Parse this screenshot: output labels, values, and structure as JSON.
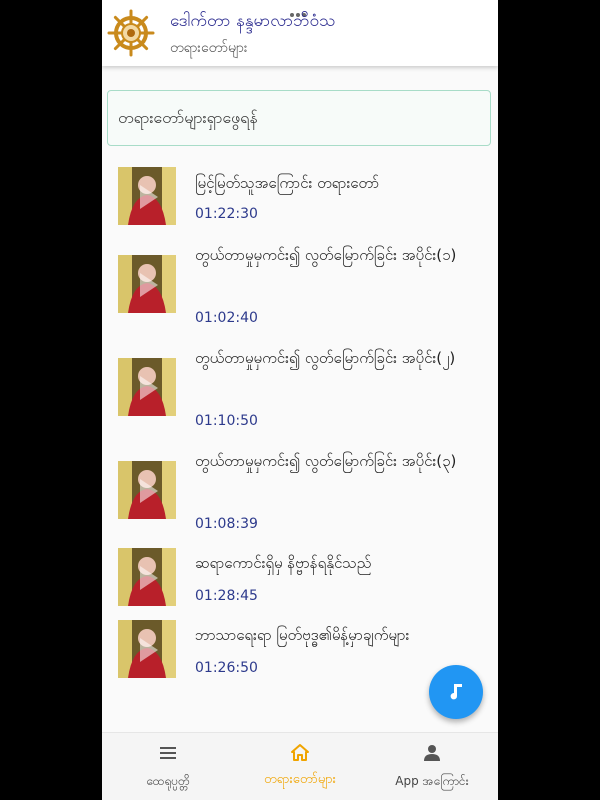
{
  "app": {
    "title": "ဒေါက်တာ နန္ဒမာလာဘိဝံသ",
    "subtitle": "တရားတော်များ"
  },
  "search": {
    "placeholder": "တရားတော်များရှာဖွေရန်"
  },
  "colors": {
    "accent": "#f0a400",
    "fab": "#2196f3",
    "time": "#2d3a8c",
    "search_border": "#a8dcc8"
  },
  "items": [
    {
      "title": "မြင့်မြတ်သူအကြောင်း တရားတော်",
      "duration": "01:22:30"
    },
    {
      "title": "တွယ်တာမှုမှကင်း၍ လွတ်မြောက်ခြင်း အပိုင်း(၁)",
      "duration": "01:02:40"
    },
    {
      "title": "တွယ်တာမှုမှကင်း၍ လွတ်မြောက်ခြင်း အပိုင်း(၂)",
      "duration": "01:10:50"
    },
    {
      "title": "တွယ်တာမှုမှကင်း၍ လွတ်မြောက်ခြင်း အပိုင်း(၃)",
      "duration": "01:08:39"
    },
    {
      "title": "ဆရာကောင်းရှိမှ နိဗ္ဗာန်ရနိုင်သည်",
      "duration": "01:28:45"
    },
    {
      "title": "ဘာသာရေးရာ မြတ်ဗုဒ္ဓ၏မိန့်မှာချက်များ",
      "duration": "01:26:50"
    }
  ],
  "fab": {
    "icon": "music-note-icon"
  },
  "nav": [
    {
      "label": "ထေရုပ္ပတ္တိ",
      "icon": "menu-icon"
    },
    {
      "label": "တရားတော်များ",
      "icon": "home-icon",
      "active": true
    },
    {
      "label": "App အကြောင်း",
      "icon": "person-icon"
    }
  ]
}
